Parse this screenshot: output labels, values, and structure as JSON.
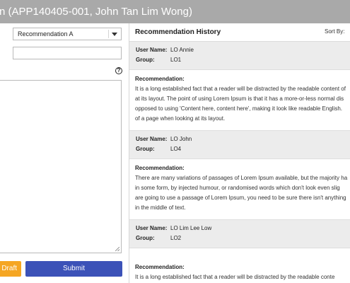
{
  "window": {
    "title": "n (APP140405-001, John Tan Lim Wong)"
  },
  "form": {
    "recommendation_select": "Recommendation A",
    "draft_label": "Draft",
    "submit_label": "Submit",
    "help_glyph": "?"
  },
  "history": {
    "title": "Recommendation History",
    "sort_label": "Sort By:",
    "user_label": "User Name:",
    "group_label": "Group:",
    "rec_label": "Recommendation:",
    "entries": [
      {
        "user": "LO Annie",
        "group": "LO1",
        "lines": [
          "It is a long established fact that a reader will be distracted by the readable content of",
          "at its layout. The point of using Lorem Ipsum is that it has a more-or-less normal dis",
          "opposed to using 'Content here, content here', making it look like readable English.",
          "of a page when looking at its layout."
        ]
      },
      {
        "user": "LO John",
        "group": "LO4",
        "lines": [
          "There are many variations of passages of Lorem Ipsum available, but the majority ha",
          "in some form, by injected humour, or randomised words which don't look even slig",
          "are going to use a passage of Lorem Ipsum, you need to be sure there isn't anything",
          "in the middle of text."
        ]
      },
      {
        "user": "LO Lim Lee Low",
        "group": "LO2",
        "lines": [
          "It is a long established fact that a reader will be distracted by the readable conte"
        ]
      }
    ]
  },
  "colors": {
    "titlebar": "#a9a9a9",
    "draft": "#f5a623",
    "submit": "#3c52b8"
  }
}
